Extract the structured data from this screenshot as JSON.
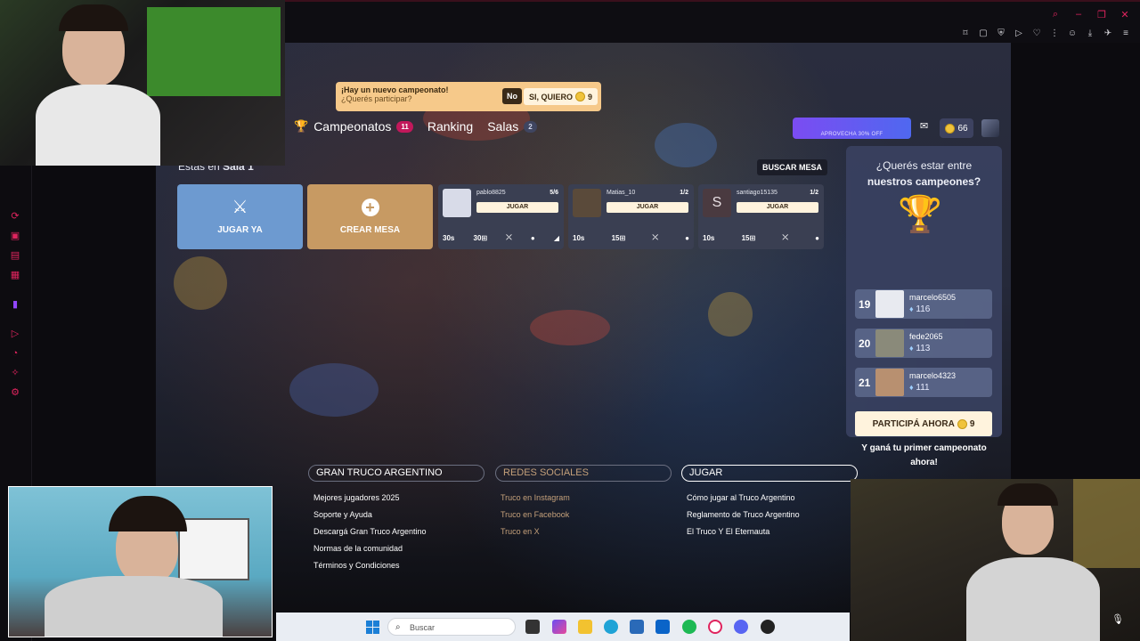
{
  "notice": {
    "title": "¡Hay un nuevo campeonato!",
    "subtitle": "¿Querés participar?",
    "no_label": "No",
    "yes_label": "SI, QUIERO",
    "yes_cost": "9"
  },
  "nav": {
    "items": [
      {
        "label": "Campeonatos",
        "badge": "11"
      },
      {
        "label": "Ranking"
      },
      {
        "label": "Salas",
        "badge": "2"
      }
    ]
  },
  "header": {
    "promo_label": "APROVECHA 30% OFF",
    "coins": "66"
  },
  "sala": {
    "prefix": "Estás en",
    "name": "Sala 1"
  },
  "buscar_mesa": "BUSCAR MESA",
  "actions": {
    "jugar_ya": "JUGAR YA",
    "crear_mesa": "CREAR MESA"
  },
  "tables": [
    {
      "player": "pablo8825",
      "count": "5/6",
      "join": "JUGAR",
      "time": "30s",
      "points": "30",
      "initial": ""
    },
    {
      "player": "Matias_10",
      "count": "1/2",
      "join": "JUGAR",
      "time": "10s",
      "points": "15",
      "initial": ""
    },
    {
      "player": "santiago15135",
      "count": "1/2",
      "join": "JUGAR",
      "time": "10s",
      "points": "15",
      "initial": "S"
    }
  ],
  "champions": {
    "title_line1": "¿Querés estar entre",
    "title_line2": "nuestros campeones?",
    "rows": [
      {
        "rank": "19",
        "name": "marcelo6505",
        "score": "116"
      },
      {
        "rank": "20",
        "name": "fede2065",
        "score": "113"
      },
      {
        "rank": "21",
        "name": "marcelo4323",
        "score": "111"
      }
    ],
    "participa_label": "PARTICIPÁ AHORA",
    "participa_cost": "9",
    "footer_line1": "Y ganá tu primer campeonato",
    "footer_line2": "ahora!"
  },
  "footer": {
    "col1": {
      "title": "GRAN TRUCO ARGENTINO",
      "links": [
        "Mejores jugadores 2025",
        "Soporte y Ayuda",
        "Descargá Gran Truco Argentino",
        "Normas de la comunidad",
        "Términos y Condiciones"
      ]
    },
    "col2": {
      "title": "REDES SOCIALES",
      "links": [
        "Truco en Instagram",
        "Truco en Facebook",
        "Truco en X"
      ]
    },
    "col3": {
      "title": "JUGAR",
      "links": [
        "Cómo jugar al Truco Argentino",
        "Reglamento de Truco Argentino",
        "El Truco Y El Eternauta"
      ]
    }
  },
  "taskbar": {
    "search_placeholder": "Buscar"
  },
  "colors": {
    "accent": "#e0245e",
    "coin": "#f0c33c",
    "card_blue": "#6d9ad0",
    "card_gold": "#c79a63",
    "panel": "#3a4262"
  }
}
